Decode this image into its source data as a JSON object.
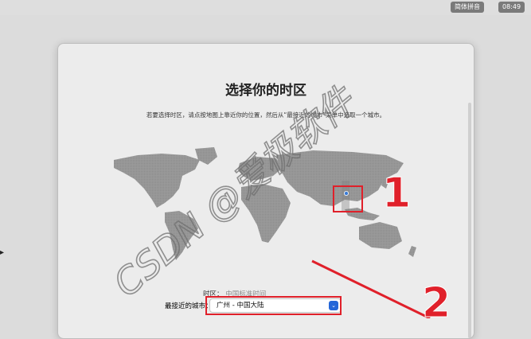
{
  "menubar": {
    "input_method": "简体拼音",
    "clock": "08:49"
  },
  "dialog": {
    "title": "选择你的时区",
    "subtitle": "若要选择时区，请点按地图上靠近你的位置，然后从“最接近的城市”菜单中选取一个城市。",
    "time_zone_label": "时区：",
    "time_zone_value": "中国标准时间",
    "closest_city_label": "最接近的城市：",
    "closest_city_value": "广州 - 中国大陆"
  },
  "annotations": {
    "marker_1": "1",
    "marker_2": "2",
    "watermark": "CSDN @爱极软件"
  },
  "colors": {
    "annotation_red": "#e0202a",
    "select_accent": "#2466d8"
  }
}
